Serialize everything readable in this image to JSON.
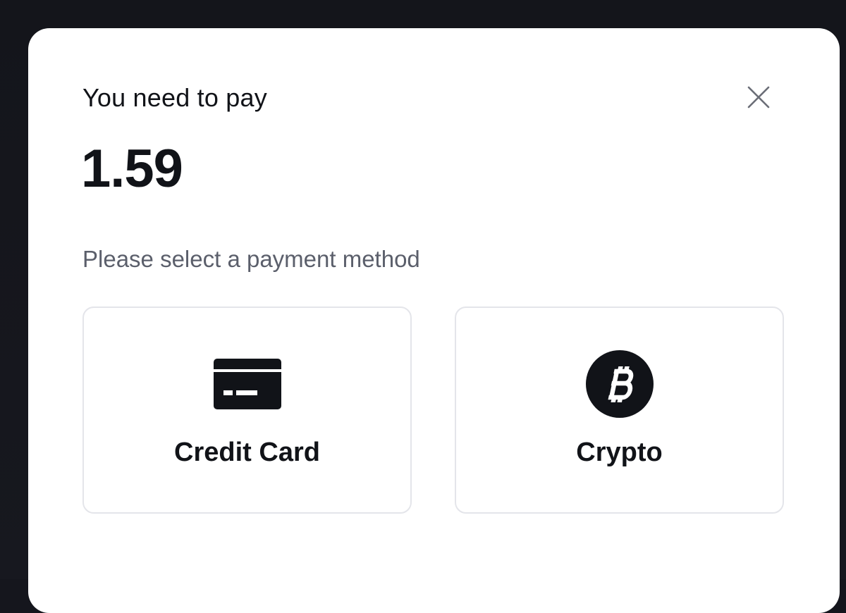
{
  "modal": {
    "title": "You need to pay",
    "amount": "1.59",
    "subtitle": "Please select a payment method",
    "close_icon": "close-icon"
  },
  "payment_methods": [
    {
      "label": "Credit Card",
      "icon": "credit-card-icon"
    },
    {
      "label": "Crypto",
      "icon": "bitcoin-icon"
    }
  ],
  "colors": {
    "backdrop": "#15161d",
    "modal_bg": "#ffffff",
    "text_primary": "#111318",
    "text_secondary": "#5b5f6b",
    "card_border": "#e4e5ea",
    "icon": "#111318"
  }
}
